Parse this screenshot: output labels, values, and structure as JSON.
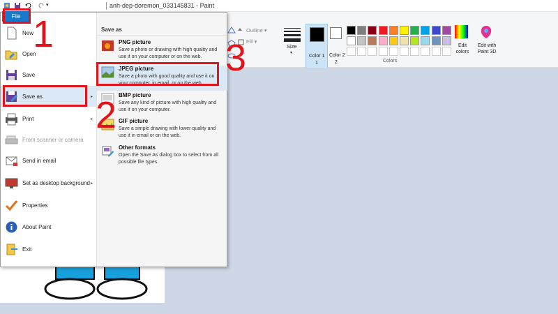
{
  "window": {
    "title": "anh-dep-doremon_033145831 - Paint"
  },
  "file_tab": {
    "label": "File"
  },
  "menu": {
    "items": [
      {
        "label": "New",
        "arrow": ""
      },
      {
        "label": "Open",
        "arrow": ""
      },
      {
        "label": "Save",
        "arrow": ""
      },
      {
        "label": "Save as",
        "arrow": "▸"
      },
      {
        "label": "Print",
        "arrow": "▸"
      },
      {
        "label": "From scanner or camera",
        "arrow": ""
      },
      {
        "label": "Send in email",
        "arrow": ""
      },
      {
        "label": "Set as desktop background",
        "arrow": "▸"
      },
      {
        "label": "Properties",
        "arrow": ""
      },
      {
        "label": "About Paint",
        "arrow": ""
      },
      {
        "label": "Exit",
        "arrow": ""
      }
    ]
  },
  "saveas": {
    "heading": "Save as",
    "items": [
      {
        "title": "PNG picture",
        "desc": "Save a photo or drawing with high quality and use it on your computer or on the web."
      },
      {
        "title": "JPEG picture",
        "desc": "Save a photo with good quality and use it on your computer, in email, or on the web."
      },
      {
        "title": "BMP picture",
        "desc": "Save any kind of picture with high quality and use it on your computer."
      },
      {
        "title": "GIF picture",
        "desc": "Save a simple drawing with lower quality and use it in email or on the web."
      },
      {
        "title": "Other formats",
        "desc": "Open the Save As dialog box to select from all possible file types."
      }
    ]
  },
  "ribbon": {
    "outline": "Outline",
    "fill": "Fill",
    "size": "Size",
    "color1": "Color 1",
    "color1_sub": "1",
    "color2": "Color 2",
    "color2_sub": "2",
    "edit_colors": "Edit colors",
    "edit_paint3d": "Edit with Paint 3D",
    "colors_group": "Colors",
    "color1_value": "#000000",
    "color2_value": "#ffffff",
    "palette_row1": [
      "#000000",
      "#7f7f7f",
      "#880015",
      "#ed1c24",
      "#ff7f27",
      "#fff200",
      "#22b14c",
      "#00a2e8",
      "#3f48cc",
      "#a349a4"
    ],
    "palette_row2": [
      "#ffffff",
      "#c3c3c3",
      "#b97a57",
      "#ffaec9",
      "#ffc90e",
      "#efe4b0",
      "#b5e61d",
      "#99d9ea",
      "#7092be",
      "#c8bfe7"
    ]
  },
  "annotations": {
    "step1": "1",
    "step2": "2",
    "step3": "3"
  },
  "accent": {
    "annotation_red": "#e0141c",
    "file_blue": "#1979ca",
    "canvas_bg": "#cdd7e6"
  }
}
